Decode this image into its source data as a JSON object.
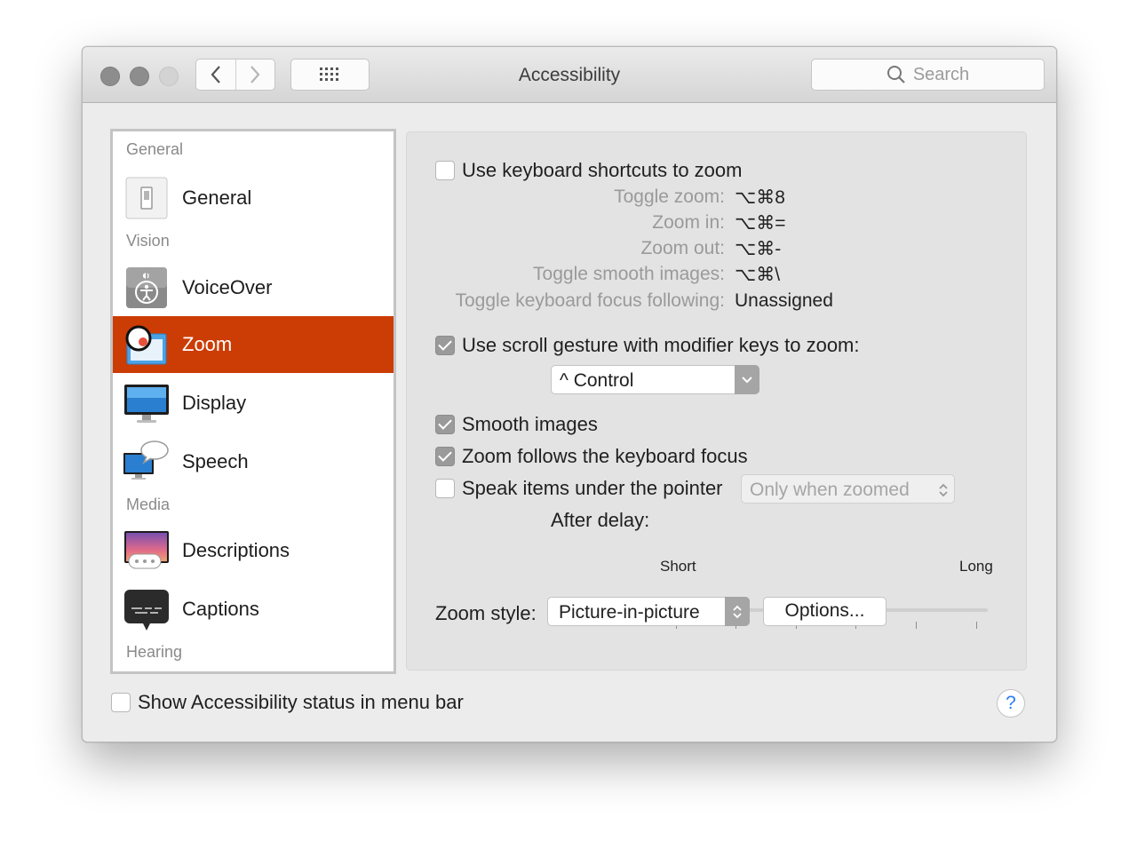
{
  "window": {
    "title": "Accessibility"
  },
  "toolbar": {
    "search_placeholder": "Search"
  },
  "sidebar": {
    "sections": {
      "general": "General",
      "vision": "Vision",
      "media": "Media",
      "hearing": "Hearing"
    },
    "items": [
      {
        "label": "General",
        "icon": "general-icon"
      },
      {
        "label": "VoiceOver",
        "icon": "voiceover-icon"
      },
      {
        "label": "Zoom",
        "icon": "zoom-icon",
        "selected": true
      },
      {
        "label": "Display",
        "icon": "display-icon"
      },
      {
        "label": "Speech",
        "icon": "speech-icon"
      },
      {
        "label": "Descriptions",
        "icon": "descriptions-icon"
      },
      {
        "label": "Captions",
        "icon": "captions-icon"
      }
    ],
    "selected_color": "#cc3c05"
  },
  "zoom": {
    "keyboard_shortcuts": {
      "label": "Use keyboard shortcuts to zoom",
      "checked": false
    },
    "shortcuts": [
      {
        "label": "Toggle zoom:",
        "value": "⌥⌘8"
      },
      {
        "label": "Zoom in:",
        "value": "⌥⌘="
      },
      {
        "label": "Zoom out:",
        "value": "⌥⌘-"
      },
      {
        "label": "Toggle smooth images:",
        "value": "⌥⌘\\"
      },
      {
        "label": "Toggle keyboard focus following:",
        "value": "Unassigned"
      }
    ],
    "scroll_gesture": {
      "label": "Use scroll gesture with modifier keys to zoom:",
      "checked": true
    },
    "modifier_popup": {
      "value": "^ Control"
    },
    "smooth_images": {
      "label": "Smooth images",
      "checked": true
    },
    "follow_focus": {
      "label": "Zoom follows the keyboard focus",
      "checked": true
    },
    "speak_items": {
      "label": "Speak items under the pointer",
      "checked": false
    },
    "speak_popup": {
      "value": "Only when zoomed"
    },
    "delay": {
      "label": "After delay:",
      "min_label": "Short",
      "max_label": "Long",
      "value": 0
    },
    "zoom_style": {
      "label": "Zoom style:",
      "value": "Picture-in-picture"
    },
    "options_button": "Options..."
  },
  "footer": {
    "status_menu": {
      "label": "Show Accessibility status in menu bar",
      "checked": false
    },
    "help": "?"
  }
}
